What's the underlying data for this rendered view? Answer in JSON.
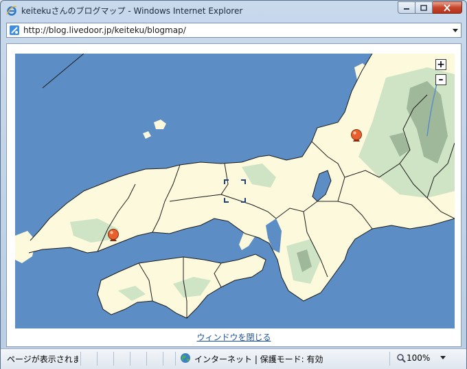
{
  "window": {
    "title": "keitekuさんのブログマップ - Windows Internet Explorer"
  },
  "address": {
    "url": "http://blog.livedoor.jp/keiteku/blogmap/"
  },
  "map": {
    "zoom_in_label": "+",
    "zoom_out_label": "–",
    "colors": {
      "sea": "#5c8dc4",
      "land": "#fdf9dc",
      "forest": "#cfe3c5",
      "mountain": "#9fb89a",
      "marker": "#e8602e"
    },
    "markers": [
      "marker-chubu",
      "marker-hiroshima"
    ]
  },
  "footer": {
    "close_link": "ウィンドウを閉じる"
  },
  "statusbar": {
    "status": "ページが表示されま",
    "zone": "インターネット | 保護モード: 有効",
    "zoom": "100%"
  },
  "icons": [
    "ie-logo-icon",
    "page-icon",
    "dropdown-icon",
    "globe-icon",
    "magnifier-icon",
    "map-marker-icon",
    "center-crosshair-icon"
  ]
}
